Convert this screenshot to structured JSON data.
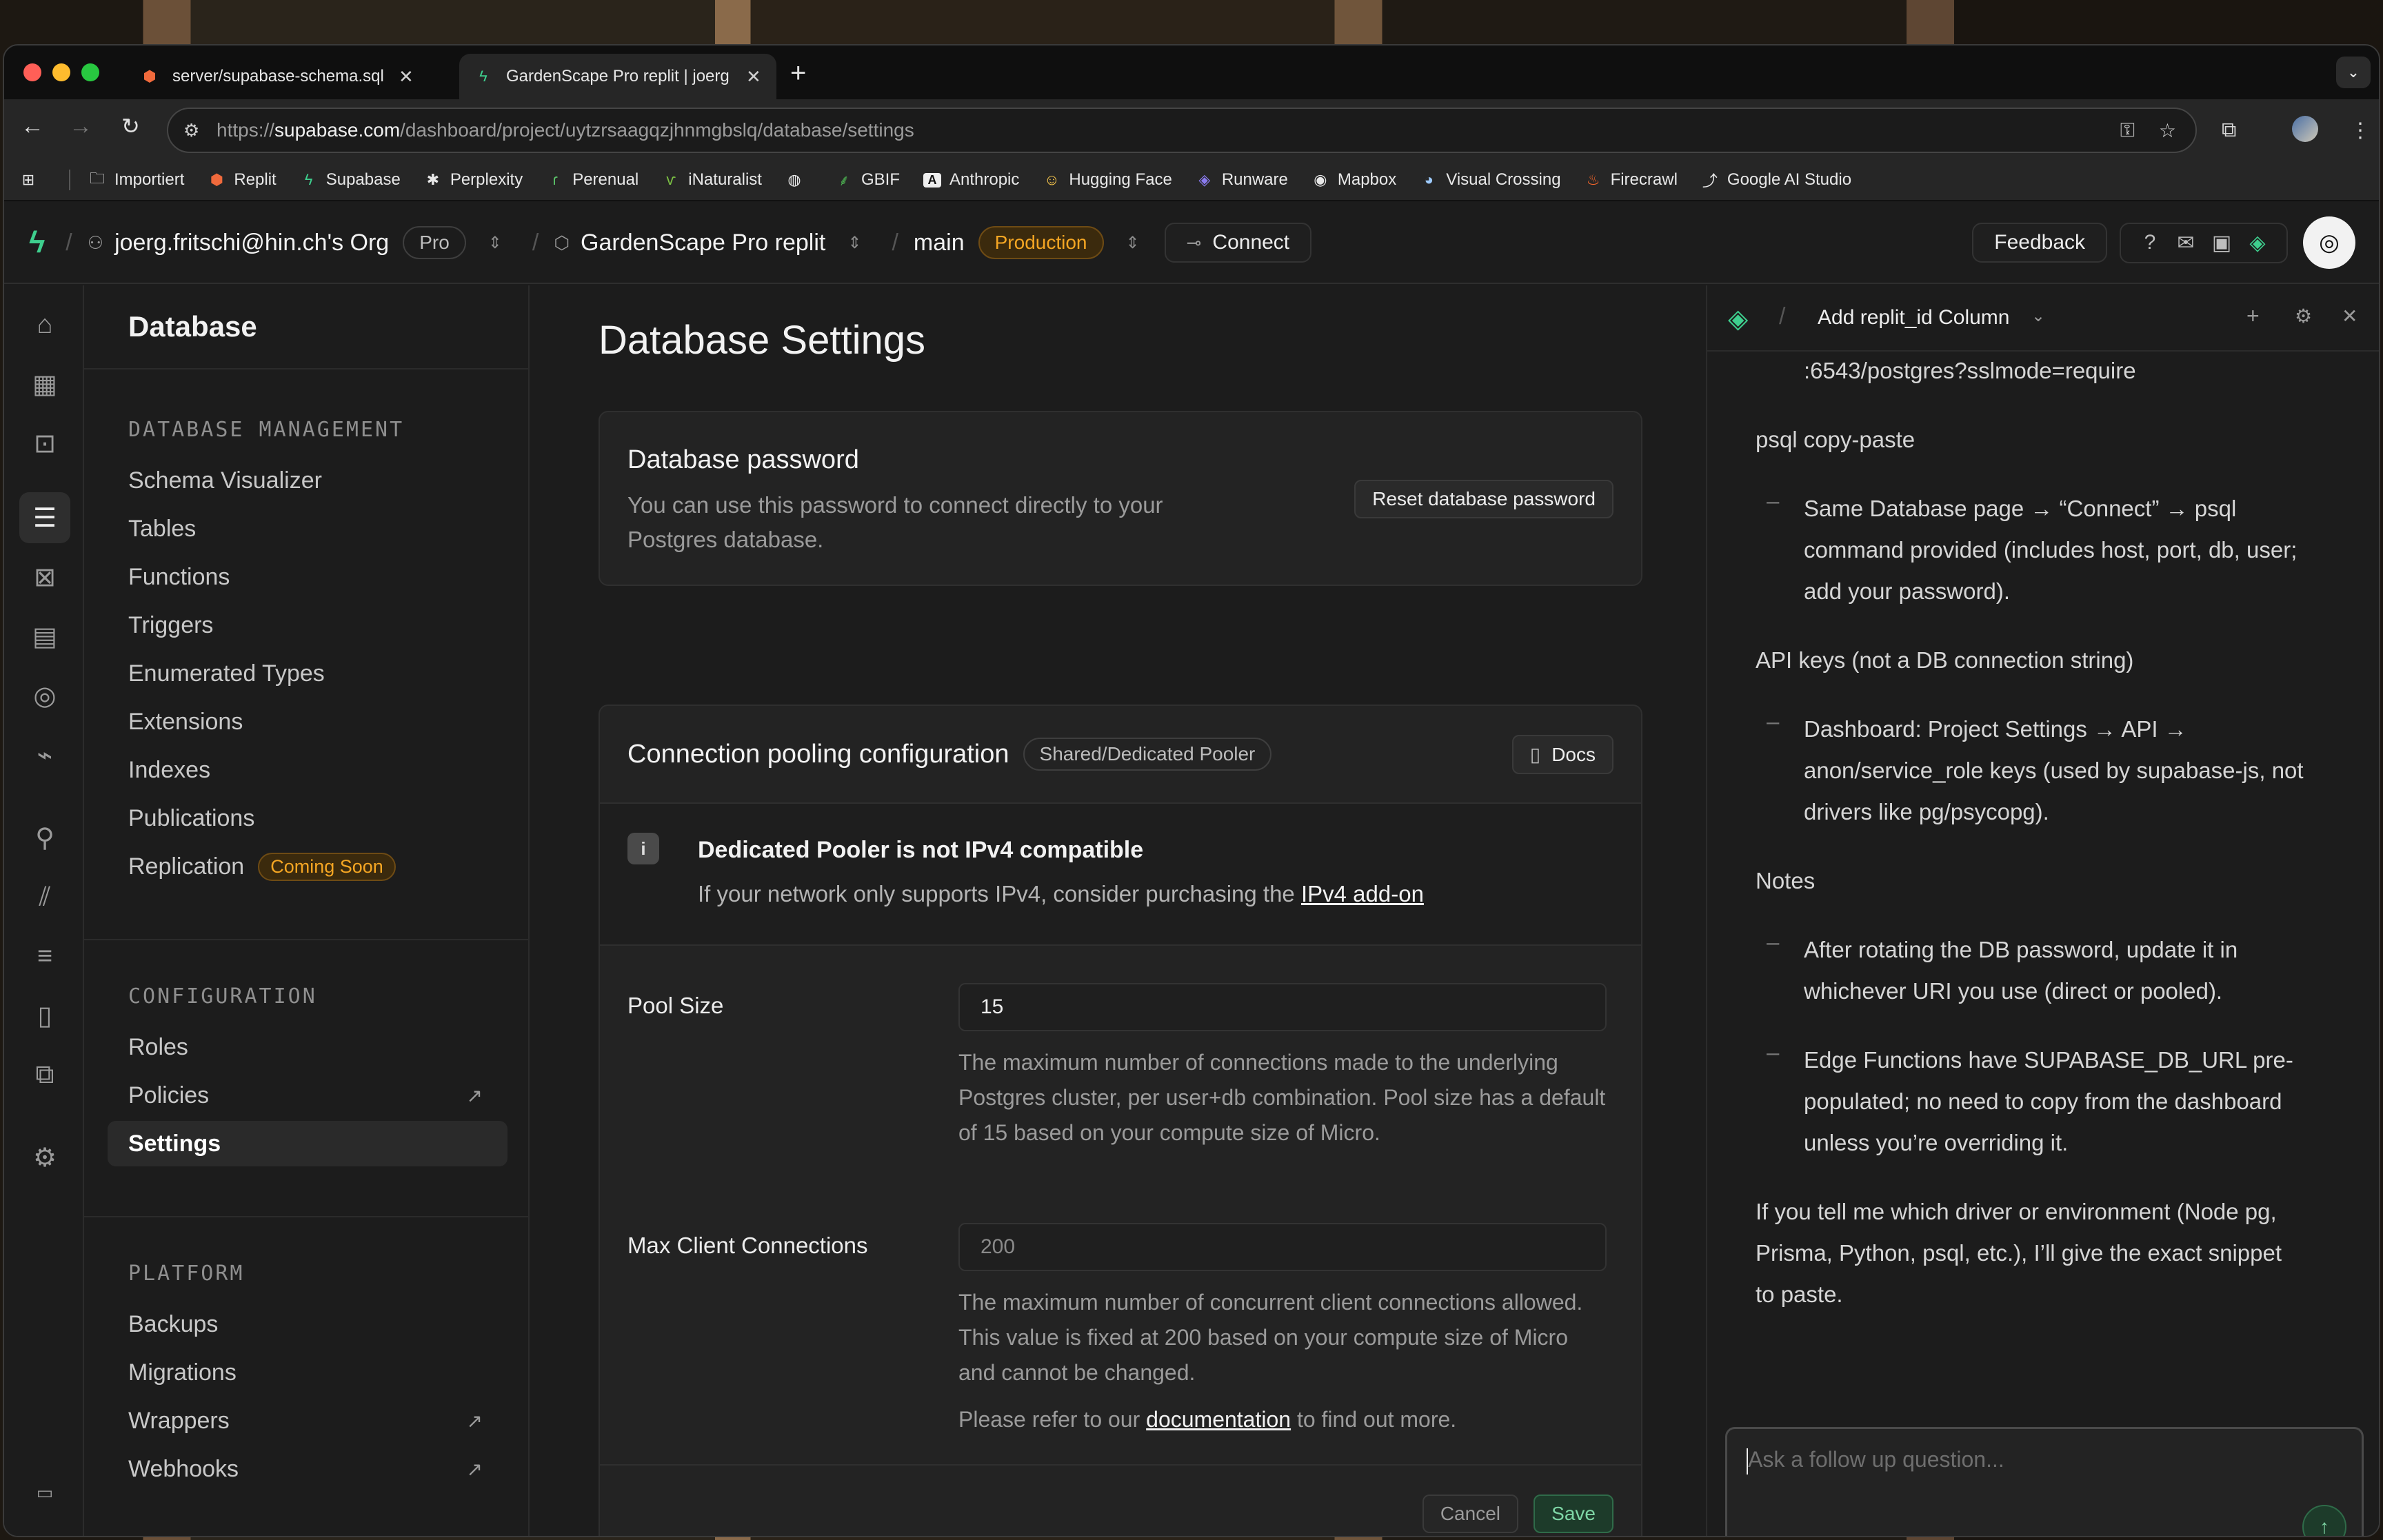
{
  "tabs": [
    {
      "title": "server/supabase-schema.sql",
      "active": false
    },
    {
      "title": "GardenScape Pro replit | joerg",
      "active": true
    }
  ],
  "url": {
    "scheme": "https://",
    "host": "supabase.com",
    "path": "/dashboard/project/uytzrsaagqzjhnmgbslq/database/settings"
  },
  "bookmarks": [
    "Importiert",
    "Replit",
    "Supabase",
    "Perplexity",
    "Perenual",
    "iNaturalist",
    "",
    "GBIF",
    "Anthropic",
    "Hugging Face",
    "Runware",
    "Mapbox",
    "Visual Crossing",
    "Firecrawl",
    "Google AI Studio"
  ],
  "topnav": {
    "org": "joerg.fritschi@hin.ch's Org",
    "plan": "Pro",
    "project": "GardenScape Pro replit",
    "branch": "main",
    "env": "Production",
    "connect": "Connect",
    "feedback": "Feedback"
  },
  "side": {
    "title": "Database",
    "section1": "DATABASE MANAGEMENT",
    "items1": [
      "Schema Visualizer",
      "Tables",
      "Functions",
      "Triggers",
      "Enumerated Types",
      "Extensions",
      "Indexes",
      "Publications",
      "Replication"
    ],
    "coming_soon": "Coming Soon",
    "section2": "CONFIGURATION",
    "items2": [
      "Roles",
      "Policies",
      "Settings"
    ],
    "section3": "PLATFORM",
    "items3": [
      "Backups",
      "Migrations",
      "Wrappers",
      "Webhooks"
    ]
  },
  "main": {
    "title": "Database Settings",
    "password": {
      "title": "Database password",
      "desc1": "You can use this password to connect directly to your",
      "desc2": "Postgres database.",
      "button": "Reset database password"
    },
    "pooling": {
      "title": "Connection pooling configuration",
      "badge": "Shared/Dedicated Pooler",
      "docs": "Docs",
      "warn_title": "Dedicated Pooler is not IPv4 compatible",
      "warn_text": "If your network only supports IPv4, consider purchasing the",
      "warn_link": "IPv4 add-on",
      "pool_label": "Pool Size",
      "pool_value": "15",
      "pool_help": "The maximum number of connections made to the underlying Postgres cluster, per user+db combination. Pool size has a default of 15 based on your compute size of Micro.",
      "max_label": "Max Client Connections",
      "max_value": "200",
      "max_help": "The maximum number of concurrent client connections allowed. This value is fixed at 200 based on your compute size of Micro and cannot be changed.",
      "refer_pre": "Please refer to our",
      "refer_link": "documentation",
      "refer_post": "to find out more.",
      "cancel": "Cancel",
      "save": "Save"
    }
  },
  "assistant": {
    "title": "Add replit_id Column",
    "lines": [
      ":6543/postgres?sslmode=require",
      "psql copy-paste",
      "Same Database page → “Connect” → psql",
      "command provided (includes host, port, db, user;",
      "add your password).",
      "API keys (not a DB connection string)",
      "Dashboard: Project Settings → API →",
      "anon/service_role keys (used by supabase-js, not",
      "drivers like pg/psycopg).",
      "Notes",
      "After rotating the DB password, update it in",
      "whichever URI you use (direct or pooled).",
      "Edge Functions have SUPABASE_DB_URL pre-",
      "populated; no need to copy from the dashboard",
      "unless you’re overriding it.",
      "If you tell me which driver or environment (Node pg,",
      "Prisma, Python, psql, etc.), I’ll give the exact snippet",
      "to paste."
    ],
    "placeholder": "Ask a follow up question..."
  },
  "colors": {
    "brand": "#3ecf8e",
    "warning": "#f5a623",
    "save_bg": "#1d3b2a"
  }
}
